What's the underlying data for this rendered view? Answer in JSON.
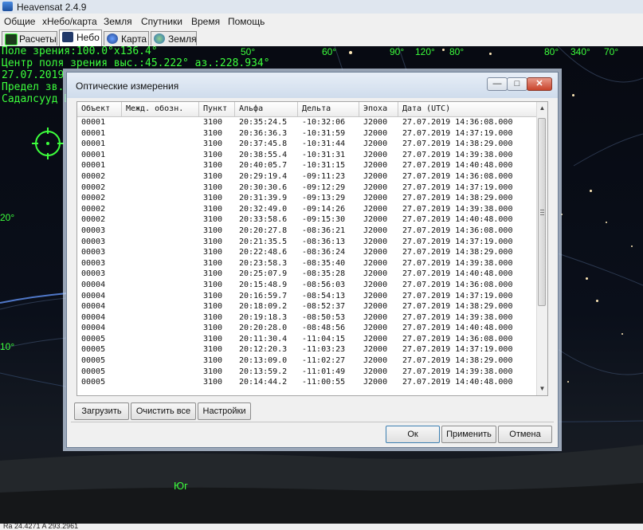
{
  "app": {
    "title": "Heavensat 2.4.9",
    "menu": [
      "Общие",
      "хНебо/карта",
      "Земля",
      "Спутники",
      "Время",
      "Помощь"
    ],
    "tabs": [
      {
        "label": "Расчеты",
        "icon": "calc-icon",
        "active": false
      },
      {
        "label": "Небо",
        "icon": "sky-icon",
        "active": true
      },
      {
        "label": "Карта",
        "icon": "map-icon",
        "active": false
      },
      {
        "label": "Земля",
        "icon": "globe-icon",
        "active": false
      }
    ]
  },
  "sky": {
    "overlay": [
      "Поле зрения:100.0°x136.4°",
      "Центр поля зрения выс.:45.222° аз.:228.934°",
      "27.07.2019",
      "Предел зв.",
      "Садалсууд Б"
    ],
    "grid_labels": [
      "50°",
      "60°",
      "90°",
      "120°",
      "80°",
      "80°",
      "340°",
      "70°",
      "20°",
      "10°"
    ],
    "compass": "Юг",
    "accent_color": "#3cff3c"
  },
  "status": {
    "text": "Ra 24.4271 A 293.2961"
  },
  "dialog": {
    "title": "Оптические измерения",
    "window_buttons": {
      "minimize": "—",
      "maximize": "□",
      "close": "✕"
    },
    "columns": [
      "Объект",
      "Межд. обозн.",
      "Пункт",
      "Альфа",
      "Дельта",
      "Эпоха",
      "Дата (UTC)"
    ],
    "rows": [
      [
        "00001",
        "",
        "3100",
        "20:35:24.5",
        "-10:32:06",
        "J2000",
        "27.07.2019 14:36:08.000"
      ],
      [
        "00001",
        "",
        "3100",
        "20:36:36.3",
        "-10:31:59",
        "J2000",
        "27.07.2019 14:37:19.000"
      ],
      [
        "00001",
        "",
        "3100",
        "20:37:45.8",
        "-10:31:44",
        "J2000",
        "27.07.2019 14:38:29.000"
      ],
      [
        "00001",
        "",
        "3100",
        "20:38:55.4",
        "-10:31:31",
        "J2000",
        "27.07.2019 14:39:38.000"
      ],
      [
        "00001",
        "",
        "3100",
        "20:40:05.7",
        "-10:31:15",
        "J2000",
        "27.07.2019 14:40:48.000"
      ],
      [
        "00002",
        "",
        "3100",
        "20:29:19.4",
        "-09:11:23",
        "J2000",
        "27.07.2019 14:36:08.000"
      ],
      [
        "00002",
        "",
        "3100",
        "20:30:30.6",
        "-09:12:29",
        "J2000",
        "27.07.2019 14:37:19.000"
      ],
      [
        "00002",
        "",
        "3100",
        "20:31:39.9",
        "-09:13:29",
        "J2000",
        "27.07.2019 14:38:29.000"
      ],
      [
        "00002",
        "",
        "3100",
        "20:32:49.0",
        "-09:14:26",
        "J2000",
        "27.07.2019 14:39:38.000"
      ],
      [
        "00002",
        "",
        "3100",
        "20:33:58.6",
        "-09:15:30",
        "J2000",
        "27.07.2019 14:40:48.000"
      ],
      [
        "00003",
        "",
        "3100",
        "20:20:27.8",
        "-08:36:21",
        "J2000",
        "27.07.2019 14:36:08.000"
      ],
      [
        "00003",
        "",
        "3100",
        "20:21:35.5",
        "-08:36:13",
        "J2000",
        "27.07.2019 14:37:19.000"
      ],
      [
        "00003",
        "",
        "3100",
        "20:22:48.6",
        "-08:36:24",
        "J2000",
        "27.07.2019 14:38:29.000"
      ],
      [
        "00003",
        "",
        "3100",
        "20:23:58.3",
        "-08:35:40",
        "J2000",
        "27.07.2019 14:39:38.000"
      ],
      [
        "00003",
        "",
        "3100",
        "20:25:07.9",
        "-08:35:28",
        "J2000",
        "27.07.2019 14:40:48.000"
      ],
      [
        "00004",
        "",
        "3100",
        "20:15:48.9",
        "-08:56:03",
        "J2000",
        "27.07.2019 14:36:08.000"
      ],
      [
        "00004",
        "",
        "3100",
        "20:16:59.7",
        "-08:54:13",
        "J2000",
        "27.07.2019 14:37:19.000"
      ],
      [
        "00004",
        "",
        "3100",
        "20:18:09.2",
        "-08:52:37",
        "J2000",
        "27.07.2019 14:38:29.000"
      ],
      [
        "00004",
        "",
        "3100",
        "20:19:18.3",
        "-08:50:53",
        "J2000",
        "27.07.2019 14:39:38.000"
      ],
      [
        "00004",
        "",
        "3100",
        "20:20:28.0",
        "-08:48:56",
        "J2000",
        "27.07.2019 14:40:48.000"
      ],
      [
        "00005",
        "",
        "3100",
        "20:11:30.4",
        "-11:04:15",
        "J2000",
        "27.07.2019 14:36:08.000"
      ],
      [
        "00005",
        "",
        "3100",
        "20:12:20.3",
        "-11:03:23",
        "J2000",
        "27.07.2019 14:37:19.000"
      ],
      [
        "00005",
        "",
        "3100",
        "20:13:09.0",
        "-11:02:27",
        "J2000",
        "27.07.2019 14:38:29.000"
      ],
      [
        "00005",
        "",
        "3100",
        "20:13:59.2",
        "-11:01:49",
        "J2000",
        "27.07.2019 14:39:38.000"
      ],
      [
        "00005",
        "",
        "3100",
        "20:14:44.2",
        "-11:00:55",
        "J2000",
        "27.07.2019 14:40:48.000"
      ]
    ],
    "buttons": {
      "load": "Загрузить",
      "clear_all": "Очистить все",
      "settings": "Настройки"
    },
    "footer": {
      "ok": "Ок",
      "apply": "Применить",
      "cancel": "Отмена"
    }
  }
}
